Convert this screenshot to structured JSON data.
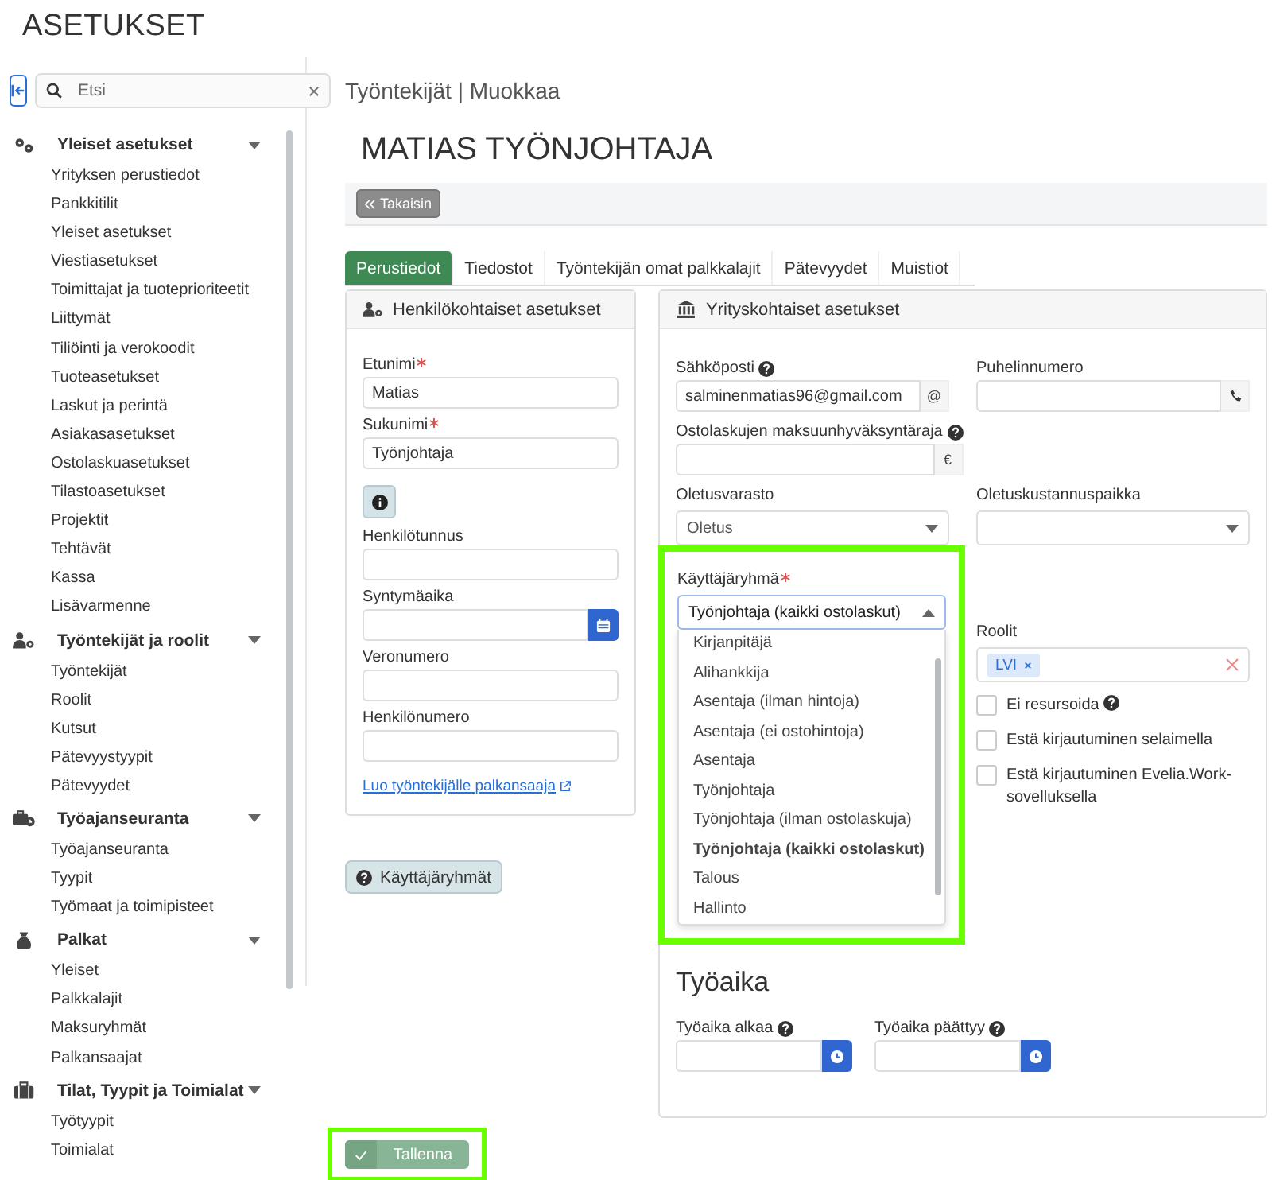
{
  "header": {
    "title": "ASETUKSET"
  },
  "sidebar": {
    "search": {
      "placeholder": "Etsi"
    },
    "sections": [
      {
        "title": "Yleiset asetukset",
        "expanded": true,
        "items": [
          "Yrityksen perustiedot",
          "Pankkitilit",
          "Yleiset asetukset",
          "Viestiasetukset",
          "Toimittajat ja tuoteprioriteetit",
          "Liittymät",
          "Tiliöinti ja verokoodit",
          "Tuoteasetukset",
          "Laskut ja perintä",
          "Asiakasasetukset",
          "Ostolaskuasetukset",
          "Tilastoasetukset",
          "Projektit",
          "Tehtävät",
          "Kassa",
          "Lisävarmenne"
        ]
      },
      {
        "title": "Työntekijät ja roolit",
        "expanded": true,
        "items": [
          "Työntekijät",
          "Roolit",
          "Kutsut",
          "Pätevyystyypit",
          "Pätevyydet"
        ]
      },
      {
        "title": "Työajanseuranta",
        "expanded": true,
        "items": [
          "Työajanseuranta",
          "Tyypit",
          "Työmaat ja toimipisteet"
        ]
      },
      {
        "title": "Palkat",
        "expanded": true,
        "items": [
          "Yleiset",
          "Palkkalajit",
          "Maksuryhmät",
          "Palkansaajat"
        ]
      },
      {
        "title": "Tilat, Tyypit ja Toimialat",
        "expanded": true,
        "items": [
          "Työtyypit",
          "Toimialat"
        ]
      }
    ]
  },
  "breadcrumb": "Työntekijät | Muokkaa",
  "page_title": "MATIAS TYÖNJOHTAJA",
  "back_button": "Takaisin",
  "tabs": [
    {
      "label": "Perustiedot",
      "selected": true
    },
    {
      "label": "Tiedostot",
      "selected": false
    },
    {
      "label": "Työntekijän omat palkkalajit",
      "selected": false
    },
    {
      "label": "Pätevyydet",
      "selected": false
    },
    {
      "label": "Muistiot",
      "selected": false
    }
  ],
  "personal_panel": {
    "title": "Henkilökohtaiset asetukset",
    "fields": [
      {
        "kind": "text",
        "label": "Etunimi",
        "required": true,
        "value": "Matias"
      },
      {
        "kind": "text",
        "label": "Sukunimi",
        "required": true,
        "value": "Työnjohtaja"
      },
      {
        "kind": "info"
      },
      {
        "kind": "text",
        "label": "Henkilötunnus",
        "required": false
      },
      {
        "kind": "date",
        "label": "Syntymäaika",
        "required": false
      },
      {
        "kind": "text",
        "label": "Veronumero",
        "required": false
      },
      {
        "kind": "text",
        "label": "Henkilönumero",
        "required": false
      }
    ],
    "link": "Luo työntekijälle palkansaaja"
  },
  "user_groups_button": "Käyttäjäryhmät",
  "company_panel": {
    "title": "Yrityskohtaiset asetukset",
    "email": {
      "label": "Sähköposti",
      "help": true,
      "value": "salminenmatias96@gmail.com",
      "addon": "@"
    },
    "phone": {
      "label": "Puhelinnumero",
      "help": false
    },
    "approval_limit": {
      "label": "Ostolaskujen maksuunhyväksyntäraja",
      "help": true,
      "addon": "€"
    },
    "warehouse": {
      "label": "Oletusvarasto",
      "value": "Oletus"
    },
    "cost_center": {
      "label": "Oletuskustannuspaikka"
    },
    "user_group": {
      "label": "Käyttäjäryhmä",
      "required": true,
      "highlighted": true,
      "value": "Työnjohtaja (kaikki ostolaskut)",
      "expanded": true,
      "options": [
        {
          "label": "Kirjanpitäjä",
          "selected": false
        },
        {
          "label": "Alihankkija",
          "selected": false
        },
        {
          "label": "Asentaja (ilman hintoja)",
          "selected": false
        },
        {
          "label": "Asentaja (ei ostohintoja)",
          "selected": false
        },
        {
          "label": "Asentaja",
          "selected": false
        },
        {
          "label": "Työnjohtaja",
          "selected": false
        },
        {
          "label": "Työnjohtaja (ilman ostolaskuja)",
          "selected": false
        },
        {
          "label": "Työnjohtaja (kaikki ostolaskut)",
          "selected": true
        },
        {
          "label": "Talous",
          "selected": false
        },
        {
          "label": "Hallinto",
          "selected": false
        }
      ]
    },
    "roles": {
      "label": "Roolit",
      "tags": [
        "LVI"
      ]
    },
    "checkboxes": [
      {
        "label": "Ei resursoida",
        "help": true,
        "checked": false
      },
      {
        "label": "Estä kirjautuminen selaimella",
        "help": false,
        "checked": false
      },
      {
        "label": "Estä kirjautuminen Evelia.Work-sovelluksella",
        "help": false,
        "checked": false
      }
    ],
    "work_time": {
      "title": "Työaika",
      "fields": [
        {
          "label": "Työaika alkaa",
          "help": true
        },
        {
          "label": "Työaika päättyy",
          "help": true
        }
      ]
    }
  },
  "save_button": {
    "label": "Tallenna",
    "highlighted": true
  }
}
